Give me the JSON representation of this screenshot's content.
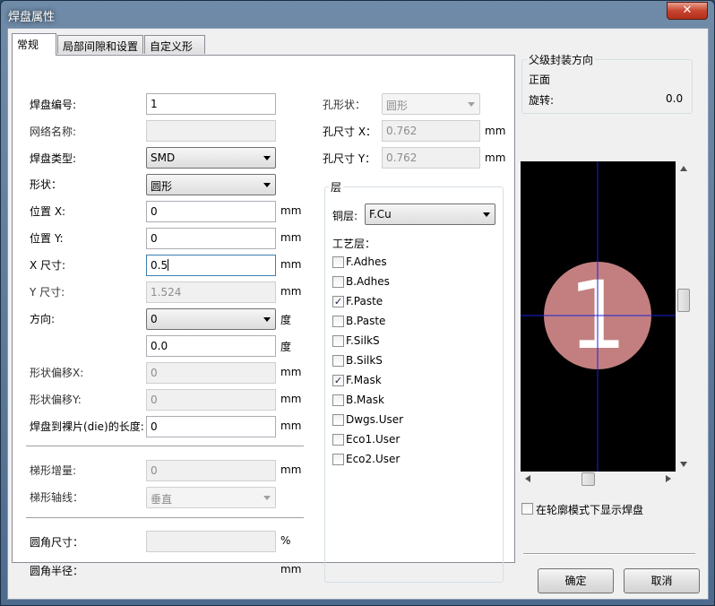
{
  "window": {
    "title": "焊盘属性",
    "close_glyph": "✕"
  },
  "tabs": [
    "常规",
    "局部间隙和设置",
    "自定义形状"
  ],
  "general": {
    "pad_number": {
      "label": "焊盘编号:",
      "value": "1"
    },
    "net_name": {
      "label": "网络名称:",
      "value": ""
    },
    "pad_type": {
      "label": "焊盘类型:",
      "value": "SMD"
    },
    "shape": {
      "label": "形状：",
      "value": "圆形"
    },
    "pos_x": {
      "label": "位置 X:",
      "value": "0",
      "unit": "mm"
    },
    "pos_y": {
      "label": "位置 Y:",
      "value": "0",
      "unit": "mm"
    },
    "size_x": {
      "label": "X 尺寸:",
      "value": "0.5",
      "unit": "mm"
    },
    "size_y": {
      "label": "Y 尺寸:",
      "value": "1.524",
      "unit": "mm"
    },
    "orientation": {
      "label": "方向:",
      "value": "0",
      "unit": "度"
    },
    "orientation_custom": {
      "value": "0.0",
      "unit": "度"
    },
    "shape_offset_x": {
      "label": "形状偏移X:",
      "value": "0",
      "unit": "mm"
    },
    "shape_offset_y": {
      "label": "形状偏移Y:",
      "value": "0",
      "unit": "mm"
    },
    "die_length": {
      "label": "焊盘到裸片(die)的长度:",
      "value": "0",
      "unit": "mm"
    },
    "trap_delta": {
      "label": "梯形增量:",
      "value": "0",
      "unit": "mm"
    },
    "trap_axis": {
      "label": "梯形轴线：",
      "value": "垂直"
    },
    "corner_size": {
      "label": "圆角尺寸：",
      "value": "",
      "unit": "%"
    },
    "corner_radius": {
      "label": "圆角半径：",
      "unit": "mm"
    }
  },
  "drill": {
    "shape": {
      "label": "孔形状：",
      "value": "圆形"
    },
    "size_x": {
      "label": "孔尺寸 X：",
      "value": "0.762",
      "unit": "mm"
    },
    "size_y": {
      "label": "孔尺寸 Y：",
      "value": "0.762",
      "unit": "mm"
    }
  },
  "layers": {
    "group_title": "层",
    "copper_label": "铜层:",
    "copper_value": "F.Cu",
    "tech_label": "工艺层：",
    "items": [
      {
        "name": "F.Adhes",
        "checked": false
      },
      {
        "name": "B.Adhes",
        "checked": false
      },
      {
        "name": "F.Paste",
        "checked": true
      },
      {
        "name": "B.Paste",
        "checked": false
      },
      {
        "name": "F.SilkS",
        "checked": false
      },
      {
        "name": "B.SilkS",
        "checked": false
      },
      {
        "name": "F.Mask",
        "checked": true
      },
      {
        "name": "B.Mask",
        "checked": false
      },
      {
        "name": "Dwgs.User",
        "checked": false
      },
      {
        "name": "Eco1.User",
        "checked": false
      },
      {
        "name": "Eco2.User",
        "checked": false
      }
    ]
  },
  "parent": {
    "title": "父级封装方向",
    "side": "正面",
    "rotation_label": "旋转:",
    "rotation_value": "0.0"
  },
  "preview": {
    "pad_label": "1",
    "pad_color": "#c37f7f",
    "crosshair_color": "#1c22d8",
    "background": "#000000"
  },
  "sketch_mode": {
    "label": "在轮廓模式下显示焊盘",
    "checked": false
  },
  "buttons": {
    "ok": "确定",
    "cancel": "取消"
  }
}
